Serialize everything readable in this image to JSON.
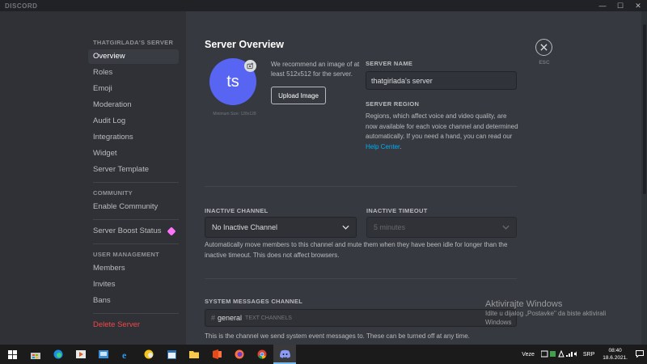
{
  "app": {
    "title": "DISCORD"
  },
  "window_controls": {
    "minimize": "—",
    "maximize": "☐",
    "close": "✕"
  },
  "sidebar": {
    "server_header": "THATGIRLADA'S SERVER",
    "items": [
      {
        "label": "Overview",
        "active": true
      },
      {
        "label": "Roles"
      },
      {
        "label": "Emoji"
      },
      {
        "label": "Moderation"
      },
      {
        "label": "Audit Log"
      },
      {
        "label": "Integrations"
      },
      {
        "label": "Widget"
      },
      {
        "label": "Server Template"
      }
    ],
    "community_header": "COMMUNITY",
    "community_items": [
      {
        "label": "Enable Community"
      }
    ],
    "boost_item": {
      "label": "Server Boost Status"
    },
    "user_mgmt_header": "USER MANAGEMENT",
    "user_mgmt_items": [
      {
        "label": "Members"
      },
      {
        "label": "Invites"
      },
      {
        "label": "Bans"
      }
    ],
    "delete_label": "Delete Server"
  },
  "main": {
    "title": "Server Overview",
    "avatar_initials": "ts",
    "min_size": "Minimum Size: 128x128",
    "upload_hint": "We recommend an image of at least 512x512 for the server.",
    "upload_button": "Upload Image",
    "server_name_label": "SERVER NAME",
    "server_name_value": "thatgirlada's server",
    "server_region_label": "SERVER REGION",
    "server_region_text": "Regions, which affect voice and video quality, are now available for each voice channel and determined automatically. If you need a hand, you can read our",
    "help_center_link": "Help Center",
    "help_center_suffix": ".",
    "inactive_channel_label": "INACTIVE CHANNEL",
    "inactive_channel_value": "No Inactive Channel",
    "inactive_timeout_label": "INACTIVE TIMEOUT",
    "inactive_timeout_value": "5 minutes",
    "inactive_help": "Automatically move members to this channel and mute them when they have been idle for longer than the inactive timeout. This does not affect browsers.",
    "system_channel_label": "SYSTEM MESSAGES CHANNEL",
    "system_channel_hash": "#",
    "system_channel_value": "general",
    "system_channel_category": "TEXT CHANNELS",
    "system_help": "This is the channel we send system event messages to. These can be turned off at any time.",
    "esc_label": "ESC"
  },
  "watermark": {
    "line1": "Aktivirajte Windows",
    "line2": "Idite u dijalog „Postavke\" da biste aktivirali Windows"
  },
  "taskbar": {
    "tray_network": "Veze",
    "tray_lang": "SRP",
    "time": "08:40",
    "date": "18.6.2021."
  },
  "colors": {
    "accent": "#5865f2",
    "link": "#00aff4",
    "danger": "#f04747",
    "boost": "#ff73fa"
  }
}
